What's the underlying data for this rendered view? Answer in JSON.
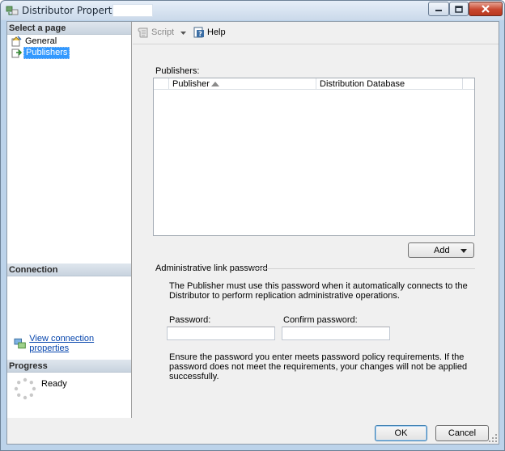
{
  "window": {
    "title": "Distributor Properties -",
    "app_icon": "distributor-properties-icon"
  },
  "left_pane": {
    "select_page": {
      "header": "Select a page",
      "items": [
        {
          "label": "General",
          "icon": "general-page-icon",
          "selected": false
        },
        {
          "label": "Publishers",
          "icon": "publishers-page-icon",
          "selected": true
        }
      ]
    },
    "connection": {
      "header": "Connection",
      "link": "View connection properties",
      "link_icon": "connection-properties-icon"
    },
    "progress": {
      "header": "Progress",
      "status": "Ready",
      "icon": "progress-spinner-icon"
    }
  },
  "toolbar": {
    "script_label": "Script",
    "script_icon": "script-icon",
    "help_label": "Help",
    "help_icon": "help-icon"
  },
  "publishers": {
    "label": "Publishers:",
    "columns": [
      {
        "label": "Publisher",
        "sort": "ascending"
      },
      {
        "label": "Distribution Database"
      }
    ],
    "rows": [],
    "add_label": "Add"
  },
  "admin_password": {
    "group_label": "Administrative link password",
    "description": "The Publisher must use this password when it automatically connects to the Distributor to perform replication administrative operations.",
    "password_label": "Password:",
    "password_value": "",
    "confirm_label": "Confirm password:",
    "confirm_value": "",
    "note": "Ensure the password you enter meets password policy requirements. If the password does not meet the requirements, your changes will not be applied successfully."
  },
  "footer": {
    "ok_label": "OK",
    "cancel_label": "Cancel"
  },
  "colors": {
    "selection": "#3399ff",
    "link": "#0645ad",
    "titlebar": "#cad9ea",
    "close_button": "#c8462e"
  }
}
